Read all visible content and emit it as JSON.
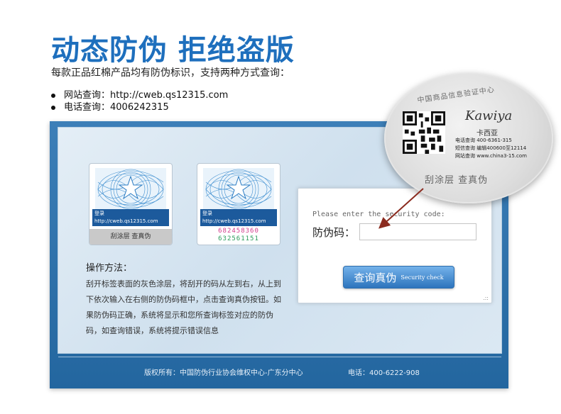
{
  "header": {
    "title": "动态防伪 拒绝盗版",
    "subtitle": "每款正品红棉产品均有防伪标识，支持两种方式查询："
  },
  "query_methods": [
    {
      "label": "网站查询：http://cweb.qs12315.com"
    },
    {
      "label": "电话查询：4006242315"
    }
  ],
  "sticker_left": {
    "line1": "登录http://cweb.qs12315.com",
    "line2": "或拨打400-6242-315查询真伪",
    "scratch_label": "刮涂层 查真伪"
  },
  "sticker_right": {
    "line1": "登录http://cweb.qs12315.com",
    "line2": "或拨打400-6242-315查询真伪",
    "code_line1": "682458360",
    "code_line2": "632561151"
  },
  "instructions": {
    "title": "操作方法：",
    "body": "刮开标签表面的灰色涂层，将刮开的码从左到右，从上到下依次输入在右侧的防伪码框中，点击查询真伪按钮。如果防伪码正确，系统将显示和您所查询标签对应的防伪码，如查询错误，系统将提示错误信息"
  },
  "query_form": {
    "prompt": "Please enter the security code:",
    "label": "防伪码：",
    "input_value": "",
    "button_label": "查询真伪",
    "button_sub": "Security check"
  },
  "magnified_label": {
    "title": "中国商品信息验证中心",
    "brand": "Kawiya",
    "brand_cn": "卡西亚",
    "line1": "电话查询 400-6361-315",
    "line2": "短信查询 编辑400600至12114",
    "line3": "网站查询 www.china3-15.com",
    "scratch_label": "刮涂层 查真伪"
  },
  "footer": {
    "copyright": "版权所有：中国防伪行业协会维权中心-广东分中心",
    "phone": "电话：400-6222-908"
  },
  "colors": {
    "title_blue": "#1e6fbd",
    "panel_blue": "#2b6ea8",
    "button_blue": "#2d74bd",
    "arrow": "#8b2b1f"
  }
}
